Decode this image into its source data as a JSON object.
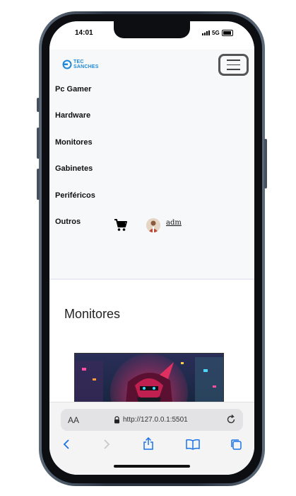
{
  "status": {
    "time": "14:01",
    "network": "5G"
  },
  "brand": {
    "line1": "TEC",
    "line2": "SANCHES",
    "color": "#1e88d8"
  },
  "nav": {
    "items": [
      {
        "label": "Pc Gamer"
      },
      {
        "label": "Hardware"
      },
      {
        "label": "Monitores"
      },
      {
        "label": "Gabinetes"
      },
      {
        "label": "Periféricos"
      },
      {
        "label": "Outros"
      }
    ],
    "user": "adm",
    "cart_icon": "cart-icon",
    "menu_icon": "hamburger-icon"
  },
  "main": {
    "title": "Monitores"
  },
  "browser": {
    "aa": "AA",
    "url": "http://127.0.0.1:5501",
    "toolbar": [
      "back-icon",
      "forward-icon",
      "share-icon",
      "bookmarks-icon",
      "tabs-icon"
    ]
  }
}
